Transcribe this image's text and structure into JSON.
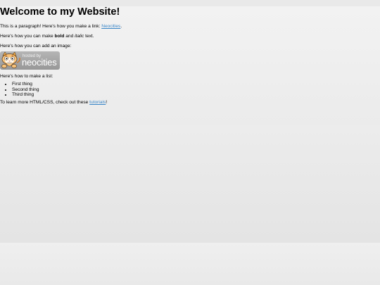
{
  "page": {
    "title": "Welcome to my Website!"
  },
  "para1": {
    "before": "This is a paragraph! Here's how you make a link: ",
    "link": "Neocities",
    "after": "."
  },
  "para2": {
    "before": "Here's how you can make ",
    "bold": "bold",
    "middle": " and ",
    "italic": "italic",
    "after": " text."
  },
  "para3": {
    "text": "Here's how you can add an image:"
  },
  "badge": {
    "small_text": "hosted by",
    "big_text": "neocities",
    "icon": "neocities-cat-logo"
  },
  "para4": {
    "text": "Here's how to make a list:"
  },
  "list": {
    "items": [
      "First thing",
      "Second thing",
      "Third thing"
    ]
  },
  "para5": {
    "before": "To learn more HTML/CSS, check out these ",
    "link": "tutorials",
    "after": "!"
  },
  "colors": {
    "link": "#3a86c8",
    "badge_bg": "#a6a6a6"
  }
}
